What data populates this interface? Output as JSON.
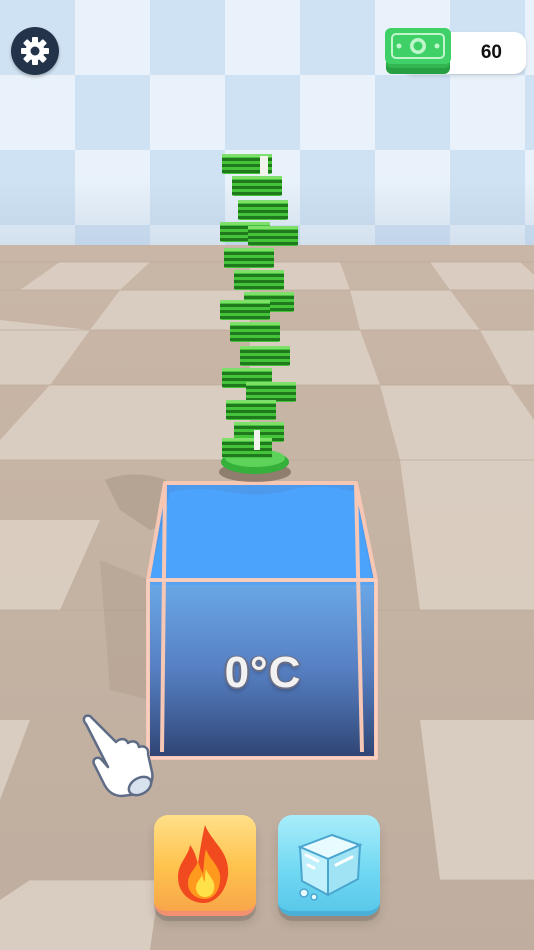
{
  "hud": {
    "cash_amount": "60",
    "settings_icon": "gear-icon",
    "cash_icon": "banknote-stack-icon"
  },
  "tank": {
    "temperature": "0°C",
    "water_color": "#3d8ff0"
  },
  "actions": {
    "fire_icon": "flame-icon",
    "ice_icon": "ice-cube-icon"
  },
  "tutorial": {
    "hand_icon": "pointing-hand-icon"
  },
  "colors": {
    "money_green": "#3cc43c",
    "settings_bg": "#23344a",
    "fire_button": "#ffc24d",
    "ice_button": "#6fd8f2"
  }
}
